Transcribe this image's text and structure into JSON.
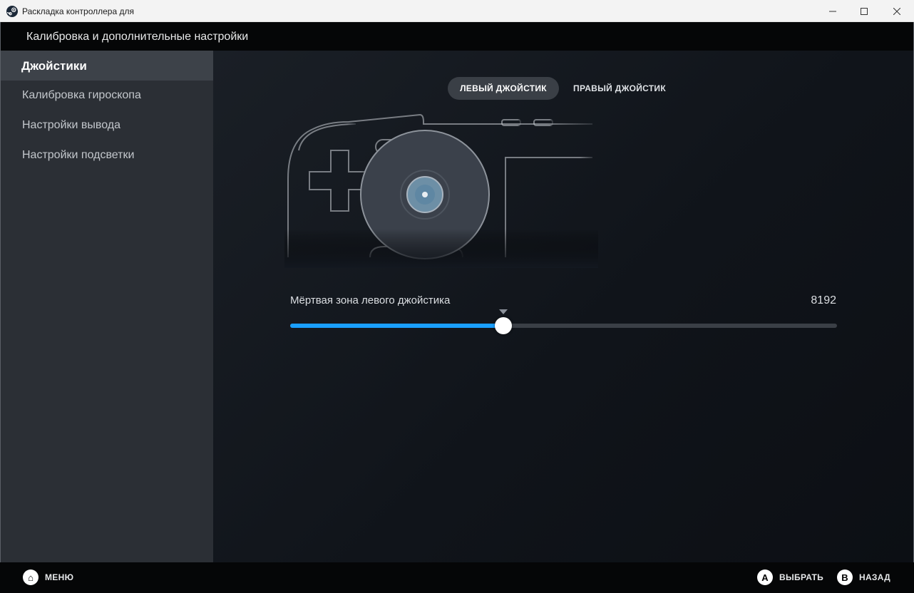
{
  "window": {
    "title": "Раскладка контроллера для",
    "icon": "steam-icon",
    "buttons": [
      "minimize-icon",
      "maximize-icon",
      "close-icon"
    ]
  },
  "header": {
    "title": "Калибровка и дополнительные настройки"
  },
  "sidebar": {
    "items": [
      {
        "label": "Джойстики",
        "active": true
      },
      {
        "label": "Калибровка гироскопа",
        "active": false
      },
      {
        "label": "Настройки вывода",
        "active": false
      },
      {
        "label": "Настройки подсветки",
        "active": false
      }
    ]
  },
  "tabs": [
    {
      "label": "ЛЕВЫЙ ДЖОЙСТИК",
      "active": true
    },
    {
      "label": "ПРАВЫЙ ДЖОЙСТИК",
      "active": false
    }
  ],
  "slider": {
    "label": "Мёртвая зона левого джойстика",
    "value": "8192",
    "fraction": 0.39,
    "accent_color": "#1a9fff"
  },
  "footer": {
    "menu": {
      "glyph": "⌂",
      "label": "МЕНЮ"
    },
    "select": {
      "glyph": "A",
      "label": "ВЫБРАТЬ"
    },
    "back": {
      "glyph": "B",
      "label": "НАЗАД"
    }
  }
}
